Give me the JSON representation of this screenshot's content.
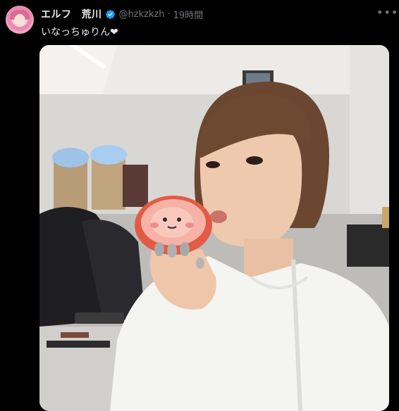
{
  "user": {
    "display_name_part1": "エルフ",
    "display_name_part2": "荒川",
    "handle": "@hzkzkzh",
    "separator": "·",
    "time_ago": "19時間"
  },
  "tweet": {
    "text": "いなっちゅりん❤"
  },
  "icons": {
    "avatar": "avatar-image",
    "verified": "verified-badge-icon",
    "more": "more-options-icon"
  },
  "colors": {
    "background": "#000000",
    "text_primary": "#e7e9ea",
    "text_secondary": "#71767b",
    "verified_blue": "#1d9bf0"
  }
}
